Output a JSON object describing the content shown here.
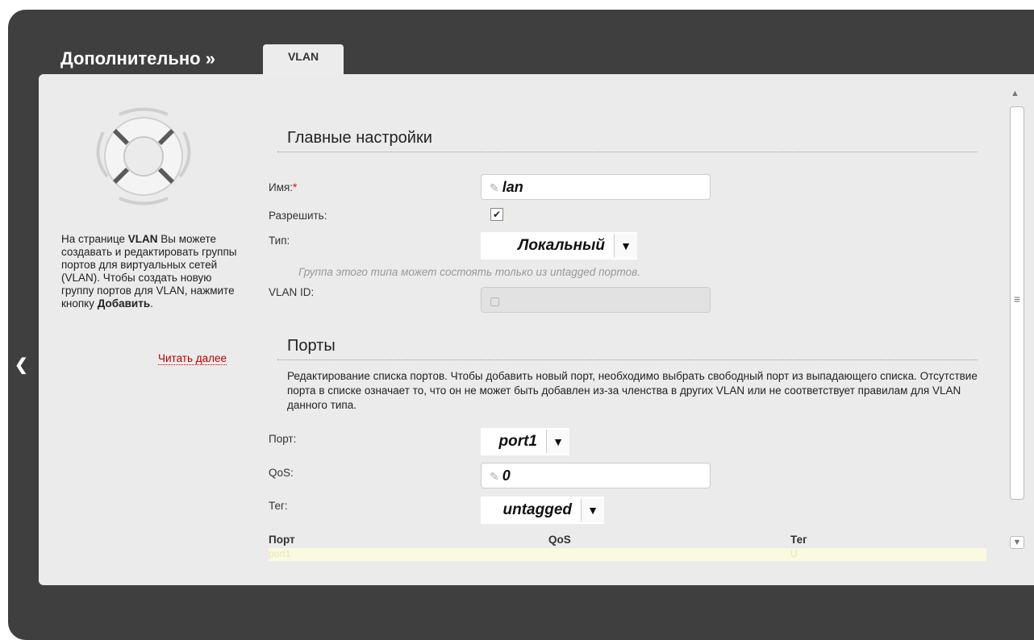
{
  "breadcrumb": "Дополнительно »",
  "tab": "VLAN",
  "help": {
    "t1": "На странице ",
    "b1": "VLAN",
    "t2": " Вы можете создавать и редактировать группы портов для виртуальных сетей (VLAN). Чтобы создать новую группу портов для VLAN, нажмите кнопку ",
    "b2": "Добавить",
    "t3": ".",
    "read_more": "Читать далее"
  },
  "main": {
    "title": "Главные настройки",
    "name_label": "Имя:",
    "required_mark": "*",
    "name_value": "lan",
    "enable_label": "Разрешить:",
    "enable_checked": true,
    "type_label": "Тип:",
    "type_value": "Локальный",
    "type_hint": "Группа этого типа может состоять только из untagged портов.",
    "vlan_id_label": "VLAN ID:",
    "vlan_id_value": ""
  },
  "ports": {
    "title": "Порты",
    "description": "Редактирование списка портов. Чтобы добавить новый порт, необходимо выбрать свободный порт из выпадающего списка. Отсутствие порта в списке означает то, что он не может быть добавлен из-за членства в других VLAN или не соответствует правилам для VLAN данного типа.",
    "port_label": "Порт:",
    "port_value": "port1",
    "qos_label": "QoS:",
    "qos_value": "0",
    "tag_label": "Тег:",
    "tag_value": "untagged",
    "table": {
      "headers": [
        "Порт",
        "QoS",
        "Тег"
      ],
      "rows": [
        [
          "port1",
          "",
          "U"
        ]
      ]
    }
  },
  "colors": {
    "frame": "#3f3f3f",
    "panel": "#ebebeb",
    "link": "#b00000",
    "required": "#e00000"
  }
}
